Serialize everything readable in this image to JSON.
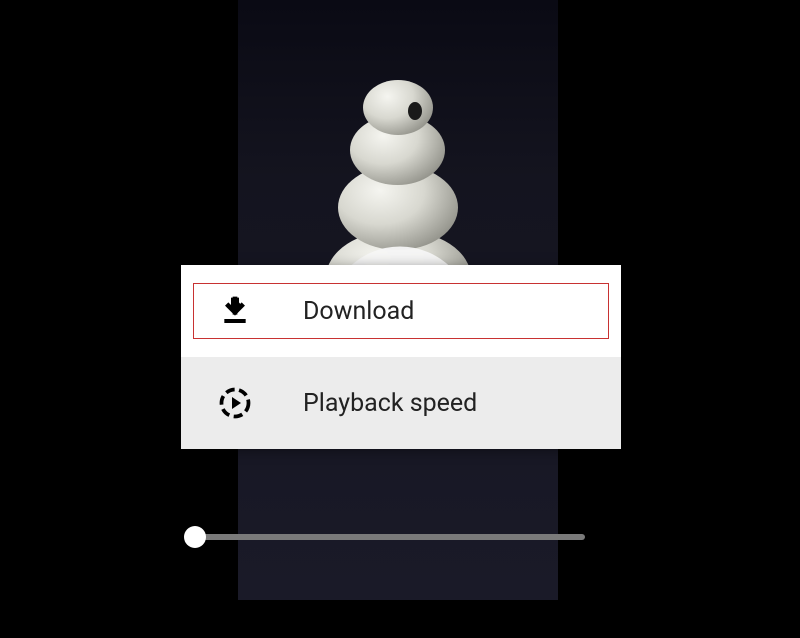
{
  "menu": {
    "items": [
      {
        "label": "Download"
      },
      {
        "label": "Playback speed"
      }
    ]
  }
}
